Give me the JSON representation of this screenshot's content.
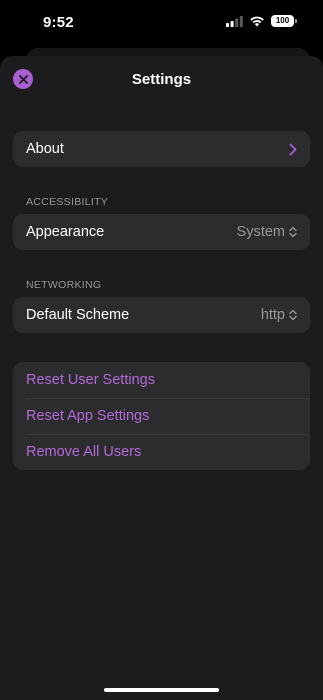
{
  "status_bar": {
    "time": "9:52",
    "battery": "100"
  },
  "sheet": {
    "title": "Settings"
  },
  "general": {
    "about_label": "About"
  },
  "accessibility": {
    "header": "ACCESSIBILITY",
    "appearance_label": "Appearance",
    "appearance_value": "System"
  },
  "networking": {
    "header": "NETWORKING",
    "scheme_label": "Default Scheme",
    "scheme_value": "http"
  },
  "actions": {
    "items": [
      {
        "label": "Reset User Settings"
      },
      {
        "label": "Reset App Settings"
      },
      {
        "label": "Remove All Users"
      }
    ]
  },
  "colors": {
    "accent": "#a95fd1",
    "action_text": "#b36ad8",
    "sheet_bg": "#1c1c1e",
    "row_bg": "#2c2c2e"
  }
}
